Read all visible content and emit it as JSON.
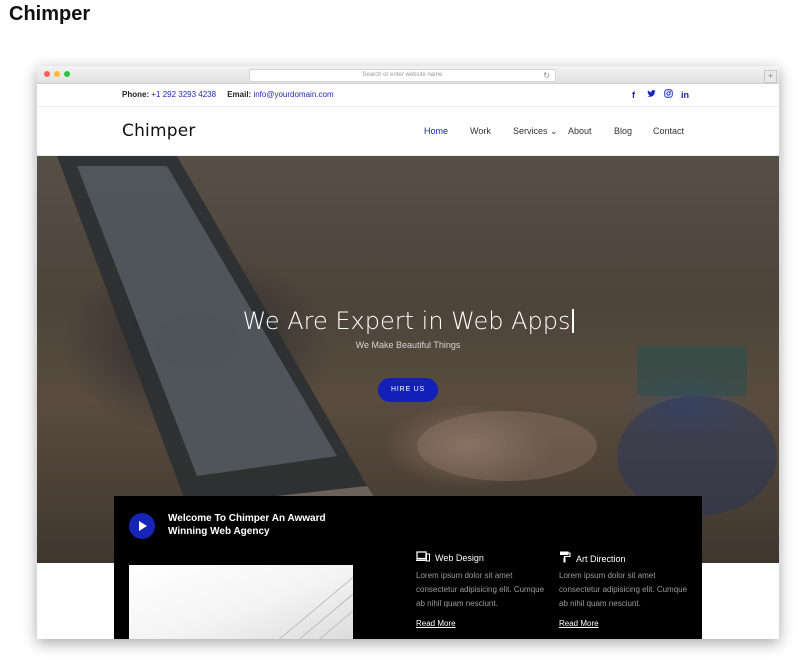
{
  "page_heading": "Chimper",
  "browser": {
    "url_placeholder": "Search or enter website name",
    "search_icon": "🔍",
    "reload_icon": "↻",
    "new_tab_icon": "+"
  },
  "topbar": {
    "phone_label": "Phone:",
    "phone_value": "+1 292 3293 4238",
    "email_label": "Email:",
    "email_value": "info@yourdomain.com",
    "social": [
      {
        "icon": "facebook-icon",
        "glyph": "f"
      },
      {
        "icon": "twitter-icon",
        "glyph": "🐦"
      },
      {
        "icon": "instagram-icon",
        "glyph": "◎"
      },
      {
        "icon": "linkedin-icon",
        "glyph": "in"
      }
    ]
  },
  "nav": {
    "brand": "Chimper",
    "items": [
      {
        "label": "Home",
        "active": true
      },
      {
        "label": "Work"
      },
      {
        "label": "Services ⌄"
      },
      {
        "label": "About"
      },
      {
        "label": "Blog"
      },
      {
        "label": "Contact"
      }
    ]
  },
  "hero": {
    "title": "We Are Expert in Web Apps",
    "subtitle": "We Make Beautiful Things",
    "button": "HIRE US"
  },
  "welcome": {
    "title": "Welcome To Chimper An Awward Winning Web Agency",
    "features": [
      {
        "icon": "laptop-mobile-icon",
        "glyph": "⊡",
        "title": "Web Design",
        "text": "Lorem ipsum dolor sit amet consectetur adipisicing elit. Cumque ab nihil quam nesciunt.",
        "link": "Read More"
      },
      {
        "icon": "paint-roller-icon",
        "glyph": "⛏",
        "title": "Art Direction",
        "text": "Lorem ipsum dolor sit amet consectetur adipisicing elit. Cumque ab nihil quam nesciunt.",
        "link": "Read More"
      }
    ]
  },
  "colors": {
    "accent": "#1624b8",
    "hero_button": "#1320b8",
    "welcome_bg": "#000000"
  }
}
